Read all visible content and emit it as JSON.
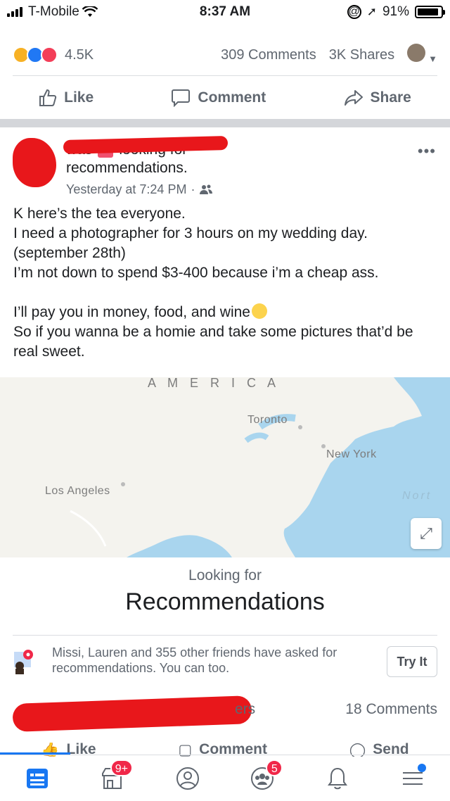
{
  "status_bar": {
    "carrier": "T-Mobile",
    "time": "8:37 AM",
    "battery": "91%",
    "battery_level": 0.91
  },
  "top_post": {
    "reaction_count": "4.5K",
    "comments": "309 Comments",
    "shares": "3K Shares",
    "actions": {
      "like": "Like",
      "comment": "Comment",
      "share": "Share"
    }
  },
  "post": {
    "header_verb": "was",
    "header_action": "looking for",
    "header_line2": "recommendations.",
    "timestamp": "Yesterday at 7:24 PM",
    "separator": "·",
    "more": "•••",
    "body": [
      "K here’s the tea everyone.",
      "I need a photographer for 3 hours on my wedding day.",
      "(september 28th)",
      "I’m not down to spend $3-400 because i’m a cheap ass.",
      "I’ll pay you in money, food, and wine",
      "So if you wanna be a homie and take some pictures that’d be real sweet."
    ]
  },
  "map": {
    "labels": {
      "america": "A M E R I C A",
      "toronto": "Toronto",
      "new_york": "New York",
      "los_angeles": "Los Angeles",
      "north": "Nort"
    },
    "land_color": "#f4f3ee",
    "water_color": "#a9d5ee"
  },
  "recommendations": {
    "label": "Looking for",
    "title": "Recommendations",
    "friends_text": "Missi, Lauren and 355 other friends have asked for recommendations. You can too.",
    "try_button": "Try It"
  },
  "post_footer": {
    "others": "ers",
    "comments": "18 Comments",
    "actions": {
      "like": "Like",
      "comment": "Comment",
      "send": "Send"
    }
  },
  "tab_bar": {
    "marketplace_badge": "9+",
    "groups_badge": "5"
  },
  "colors": {
    "brand": "#1877f2",
    "redaction": "#e8171b",
    "badge": "#f02849"
  }
}
